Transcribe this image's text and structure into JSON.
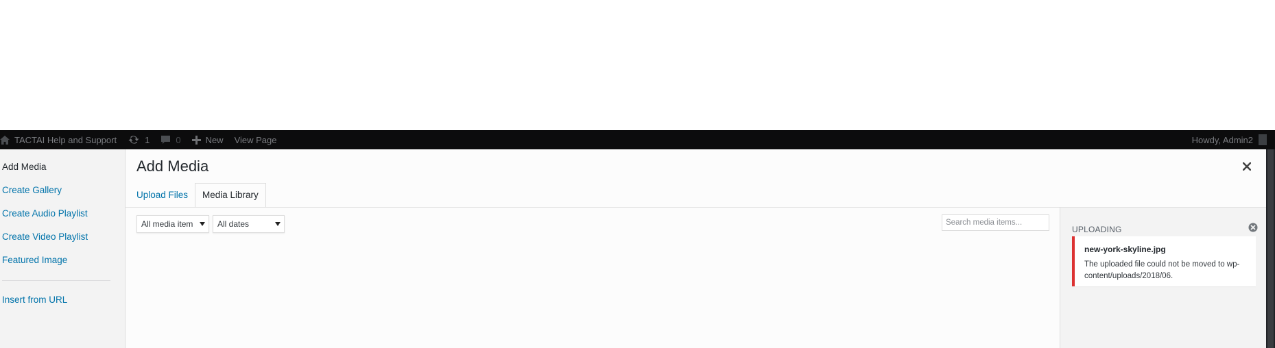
{
  "adminbar": {
    "site_name": "TACTAI Help and Support",
    "updates_count": "1",
    "comments_count": "0",
    "new_label": "New",
    "view_page_label": "View Page",
    "howdy": "Howdy, Admin2",
    "icons": [
      "home-icon",
      "updates-icon",
      "comments-icon",
      "plus-icon"
    ]
  },
  "menu": {
    "items": [
      {
        "label": "Add Media",
        "active": true
      },
      {
        "label": "Create Gallery"
      },
      {
        "label": "Create Audio Playlist"
      },
      {
        "label": "Create Video Playlist"
      },
      {
        "label": "Featured Image"
      },
      {
        "label": "Insert from URL"
      }
    ]
  },
  "modal": {
    "title": "Add Media",
    "tabs": [
      {
        "label": "Upload Files"
      },
      {
        "label": "Media Library",
        "active": true
      }
    ]
  },
  "toolbar": {
    "type_filter": "All media item",
    "date_filter": "All dates",
    "search_placeholder": "Search media items..."
  },
  "uploading": {
    "title": "UPLOADING",
    "file": "new-york-skyline.jpg",
    "error": "The uploaded file could not be moved to wp-content/uploads/2018/06."
  },
  "colors": {
    "adminbar_bg": "#0c0c0d",
    "link": "#0073aa",
    "error_border": "#dc3232"
  }
}
